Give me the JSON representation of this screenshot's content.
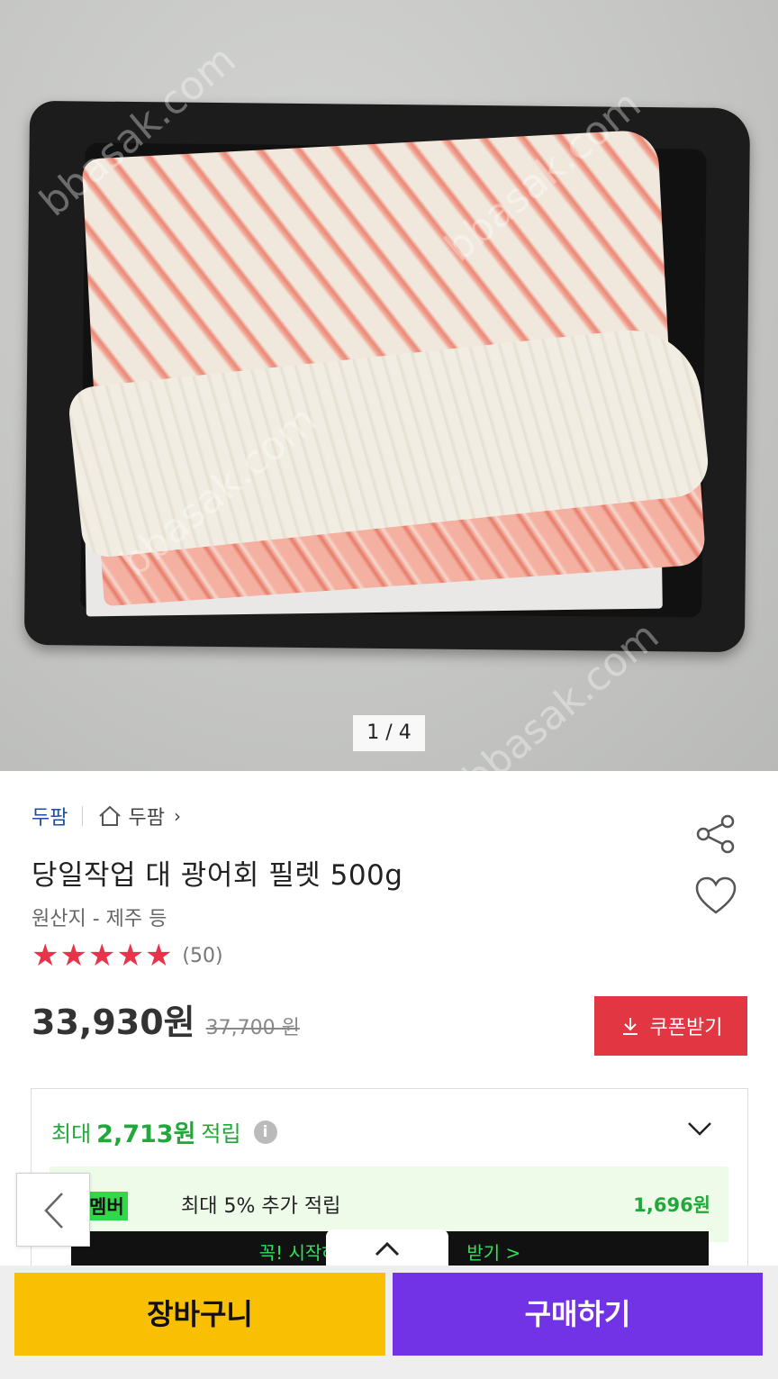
{
  "gallery": {
    "counter": "1 / 4",
    "watermark": "bbasak.com"
  },
  "store": {
    "name": "두팜",
    "home_label": "두팜",
    "chevron": "›"
  },
  "product": {
    "title": "당일작업 대 광어회 필렛 500g",
    "origin": "원산지 - 제주 등",
    "rating": 5,
    "stars": [
      "★",
      "★",
      "★",
      "★",
      "★"
    ],
    "review_count": "(50)",
    "price": "33,930원",
    "original_price": "37,700 원"
  },
  "coupon": {
    "label": "쿠폰받기"
  },
  "points": {
    "prefix": "최대",
    "amount": "2,713원",
    "suffix": "적립",
    "info_glyph": "i",
    "member_badge": "멤버",
    "member_text": "최대 5% 추가 적립",
    "member_amount": "1,696원",
    "promo_left": "꼭! 시작하",
    "promo_right": "받기 >"
  },
  "actions": {
    "cart_label": "장바구니",
    "buy_label": "구매하기"
  },
  "colors": {
    "coupon": "#e23642",
    "points_green": "#21a83b",
    "cart_yellow": "#f9c003",
    "buy_purple": "#7232e6",
    "star_red": "#e8344a",
    "store_blue": "#1a4fa0"
  },
  "icons": [
    "home-icon",
    "share-icon",
    "heart-icon",
    "download-icon",
    "info-icon",
    "chevron-down-icon",
    "chevron-left-icon",
    "chevron-up-icon"
  ]
}
